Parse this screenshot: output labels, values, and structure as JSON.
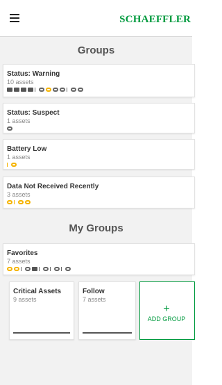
{
  "header": {
    "brand": "SCHAEFFLER"
  },
  "groups_section": {
    "title": "Groups"
  },
  "group_cards": [
    {
      "title": "Status: Warning",
      "subtitle": "10 assets",
      "icons": [
        "dark-box",
        "dark-box",
        "dark-box",
        "dark-box",
        "dark-tick-ring",
        "yellow-box",
        "dark-ring",
        "dark-ring-tick",
        "dark-tick-ring",
        "dark-ring"
      ]
    },
    {
      "title": "Status: Suspect",
      "subtitle": "1 assets",
      "icons": [
        "dark-ring"
      ]
    },
    {
      "title": "Battery Low",
      "subtitle": "1 assets",
      "icons": [
        "yellow-tick-ring"
      ]
    },
    {
      "title": "Data Not Received Recently",
      "subtitle": "3 assets",
      "icons": [
        "yellow-ring",
        "yellow-tick-ring",
        "yellow-ring"
      ]
    }
  ],
  "my_groups_section": {
    "title": "My Groups"
  },
  "favorites": {
    "title": "Favorites",
    "subtitle": "7 assets",
    "icons": [
      "yellow-ring",
      "yellow-ring",
      "dark-tick-ring",
      "dark-box",
      "dark-tick-ring",
      "dark-tick-ring",
      "dark-tick-ring"
    ]
  },
  "tiles": [
    {
      "title": "Critical Assets",
      "subtitle": "9 assets"
    },
    {
      "title": "Follow",
      "subtitle": "7 assets"
    }
  ],
  "add_group": {
    "plus": "+",
    "label": "ADD GROUP"
  },
  "colors": {
    "brand": "#009a3e",
    "warning": "#f5b400",
    "icon": "#555555"
  }
}
